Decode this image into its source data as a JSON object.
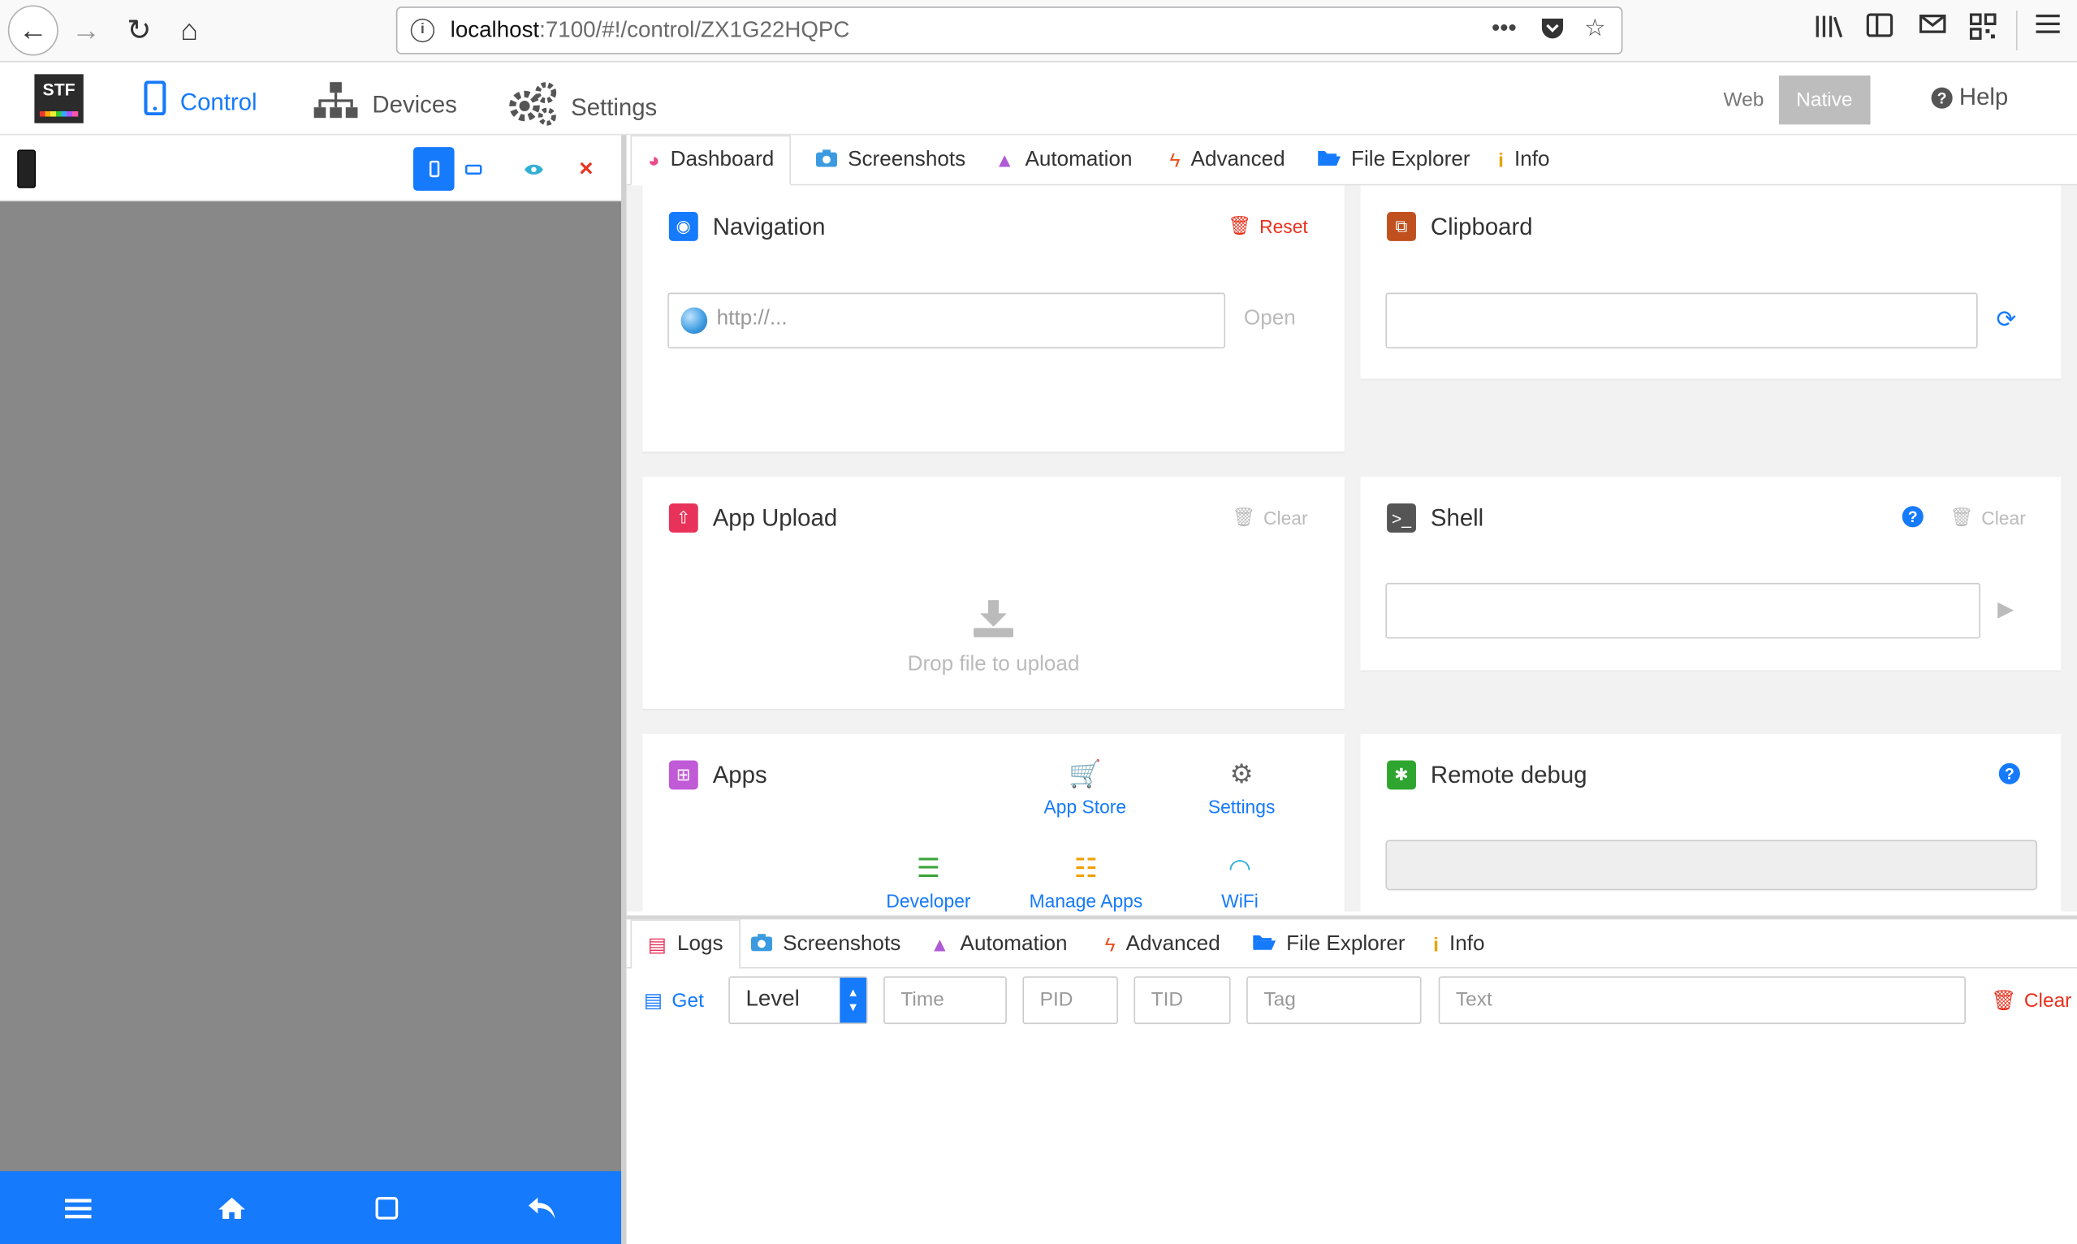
{
  "browser": {
    "url_host": "localhost",
    "url_path": ":7100/#!/control/ZX1G22HQPC"
  },
  "navbar": {
    "logo_text": "STF",
    "items": [
      {
        "label": "Control"
      },
      {
        "label": "Devices"
      },
      {
        "label": "Settings"
      }
    ],
    "mode_web": "Web",
    "mode_native": "Native",
    "help": "Help"
  },
  "top_tabs": [
    "Dashboard",
    "Screenshots",
    "Automation",
    "Advanced",
    "File Explorer",
    "Info"
  ],
  "navigation": {
    "title": "Navigation",
    "reset": "Reset",
    "url_placeholder": "http://...",
    "open": "Open"
  },
  "clipboard": {
    "title": "Clipboard"
  },
  "app_upload": {
    "title": "App Upload",
    "clear": "Clear",
    "drop_text": "Drop file to upload"
  },
  "shell": {
    "title": "Shell",
    "clear": "Clear"
  },
  "apps": {
    "title": "Apps",
    "buttons": [
      "App Store",
      "Settings",
      "Developer",
      "Manage Apps",
      "WiFi"
    ]
  },
  "remote_debug": {
    "title": "Remote debug"
  },
  "bottom_tabs": [
    "Logs",
    "Screenshots",
    "Automation",
    "Advanced",
    "File Explorer",
    "Info"
  ],
  "logs": {
    "get": "Get",
    "level": "Level",
    "time": "Time",
    "pid": "PID",
    "tid": "TID",
    "tag": "Tag",
    "text": "Text",
    "clear": "Clear"
  },
  "colors": {
    "accent": "#157afb",
    "danger": "#e8321e",
    "pane_gray": "#888888"
  }
}
